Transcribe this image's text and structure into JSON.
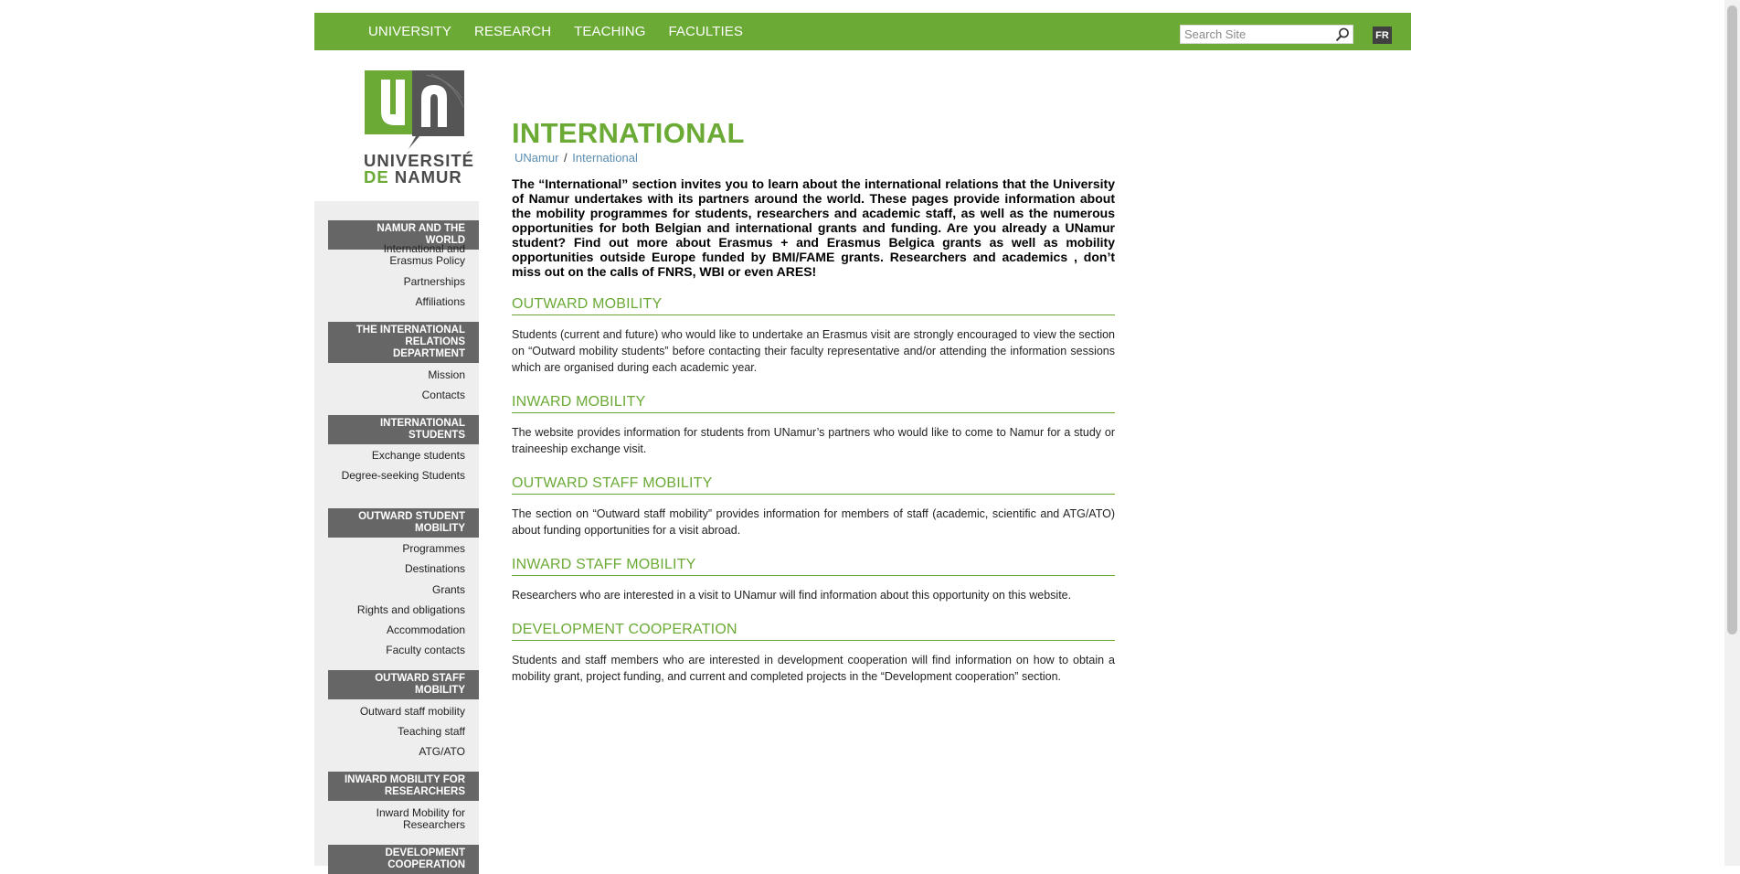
{
  "colors": {
    "accent": "#6aaa35",
    "sidebar_header": "#666666",
    "sidebar_bg": "#eeeeee",
    "link": "#5b8db0"
  },
  "topnav": {
    "items": [
      "UNIVERSITY",
      "RESEARCH",
      "TEACHING",
      "FACULTIES"
    ],
    "search_placeholder": "Search Site",
    "lang": "FR"
  },
  "logo": {
    "line1": "UNIVERSITÉ",
    "line2a": "DE",
    "line2b": "NAMUR"
  },
  "sidebar": {
    "sections": [
      {
        "title": "NAMUR AND THE WORLD",
        "items": [
          "International and Erasmus Policy",
          "Partnerships",
          "Affiliations"
        ]
      },
      {
        "title": "THE INTERNATIONAL RELATIONS DEPARTMENT",
        "items": [
          "Mission",
          "Contacts"
        ]
      },
      {
        "title": "INTERNATIONAL STUDENTS",
        "items": [
          "Exchange students",
          "Degree-seeking Students"
        ]
      },
      {
        "title": "OUTWARD STUDENT MOBILITY",
        "items": [
          "Programmes",
          "Destinations",
          "Grants",
          "Rights and obligations",
          "Accommodation",
          "Faculty contacts"
        ]
      },
      {
        "title": "OUTWARD STAFF MOBILITY",
        "items": [
          "Outward staff mobility",
          "Teaching staff",
          "ATG/ATO"
        ]
      },
      {
        "title": "INWARD MOBILITY FOR RESEARCHERS",
        "items": [
          "Inward Mobility for Researchers"
        ]
      },
      {
        "title": "DEVELOPMENT COOPERATION",
        "items": []
      }
    ]
  },
  "main": {
    "title": "INTERNATIONAL",
    "breadcrumb": {
      "home": "UNamur",
      "sep": "/",
      "current": "International"
    },
    "lead": "The “International” section invites you to learn about the international relations that the University of Namur undertakes with its partners around the world. These pages provide information about the mobility programmes for students, researchers and academic staff, as well as the numerous opportunities for both Belgian and international grants and funding. Are you already a UNamur student? Find out more about Erasmus + and Erasmus Belgica grants as well as mobility opportunities outside Europe funded by BMI/FAME grants. Researchers and academics , don’t miss out on the calls of FNRS, WBI or even ARES!",
    "sections": [
      {
        "heading": "OUTWARD MOBILITY",
        "text": "Students (current and future) who would like to undertake an Erasmus visit are strongly encouraged to view the section on “Outward mobility students” before contacting their faculty representative and/or attending the information sessions which are organised during each academic year."
      },
      {
        "heading": "INWARD MOBILITY",
        "text": "The website provides information for students from UNamur’s partners who would like to come to Namur for a study or traineeship exchange visit."
      },
      {
        "heading": "OUTWARD STAFF MOBILITY",
        "text": "The section on “Outward staff mobility” provides information for members of staff (academic, scientific and ATG/ATO) about funding opportunities for a visit abroad."
      },
      {
        "heading": "INWARD STAFF MOBILITY",
        "text": "Researchers who are interested in a visit to UNamur will find information about this opportunity on this website."
      },
      {
        "heading": "DEVELOPMENT COOPERATION",
        "text": "Students and staff members who are interested in development cooperation will find information on how to obtain a mobility grant, project funding, and current and completed projects in the “Development cooperation” section."
      }
    ]
  }
}
